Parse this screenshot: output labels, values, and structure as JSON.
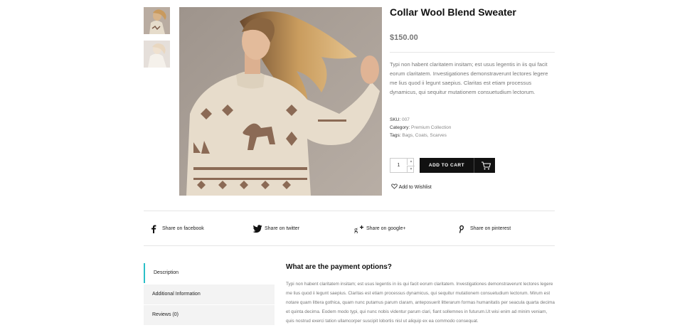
{
  "product": {
    "title": "Collar Wool Blend Sweater",
    "price": "$150.00",
    "description": "Typi non habent claritatem insitam; est usus legentis in iis qui facit eorum claritatem. Investigationes demonstraverunt lectores legere me lius quod ii legunt saepius. Claritas est etiam processus dynamicus, qui sequitur mutationem consuetudium lectorum.",
    "sku_label": "SKU:",
    "sku_value": "007",
    "category_label": "Category:",
    "category_value": "Premium Collection",
    "tags_label": "Tags:",
    "tags_value": "Bags, Coats, Scarves",
    "quantity": "1",
    "add_to_cart": "ADD TO CART",
    "wishlist": "Add to Wishlist"
  },
  "share": [
    {
      "label": "Share on facebook",
      "icon": "facebook-icon"
    },
    {
      "label": "Share on twitter",
      "icon": "twitter-icon"
    },
    {
      "label": "Share on google+",
      "icon": "google-plus-icon"
    },
    {
      "label": "Share on pinterest",
      "icon": "pinterest-icon"
    }
  ],
  "tabs": [
    "Description",
    "Additional Information",
    "Reviews (0)"
  ],
  "panel": {
    "title": "What are the payment options?",
    "text": "Typi non habent claritatem insitam; est usus legentis in iis qui facit eorum claritatem. Investigationes demonstraverunt lectores legere me lius quod ii legunt saepius. Claritas est etiam processus dynamicus, qui sequitur mutationem consuetudium lectorum. Mirum est notare quam littera gothica, quam nunc putamus parum claram, anteposuerit litterarum formas humanitatis per seacula quarta decima et quinta decima. Eodem modo typi, qui nunc nobis videntur parum clari, fiant sollemnes in futurum.Ut wisi enim ad minim veniam, quis nostrud exerci tation ullamcorper suscipit lobortis nisl ut aliquip ex ea commodo consequat."
  },
  "colors": {
    "accent": "#2bbfc8",
    "button": "#111111"
  }
}
